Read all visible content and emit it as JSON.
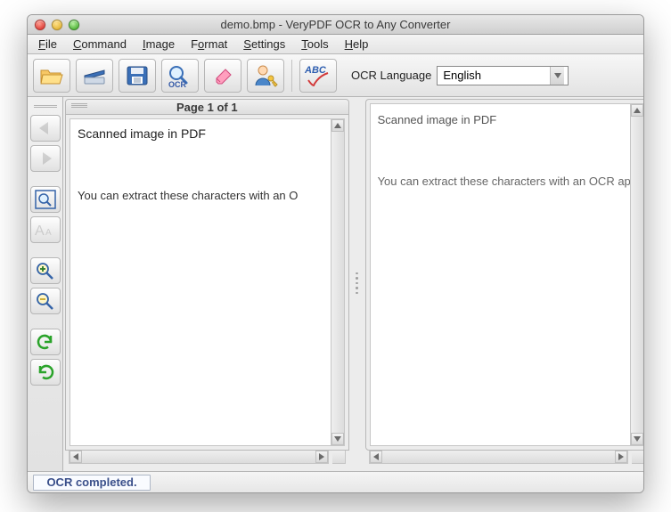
{
  "window": {
    "title": "demo.bmp - VeryPDF OCR to Any Converter"
  },
  "menu": {
    "file": "File",
    "command": "Command",
    "image": "Image",
    "format": "Format",
    "settings": "Settings",
    "tools": "Tools",
    "help": "Help"
  },
  "toolbar": {
    "ocr_label": "OCR",
    "abc_label": "ABC",
    "language_label": "OCR Language",
    "language_value": "English"
  },
  "pages": {
    "header": "Page 1 of 1"
  },
  "document": {
    "left_line1": "Scanned image in PDF",
    "left_line2": "You can extract these characters with an O",
    "right_line1": "Scanned image in PDF",
    "right_line2": "You can extract these characters with an OCR applic"
  },
  "status": "OCR completed."
}
